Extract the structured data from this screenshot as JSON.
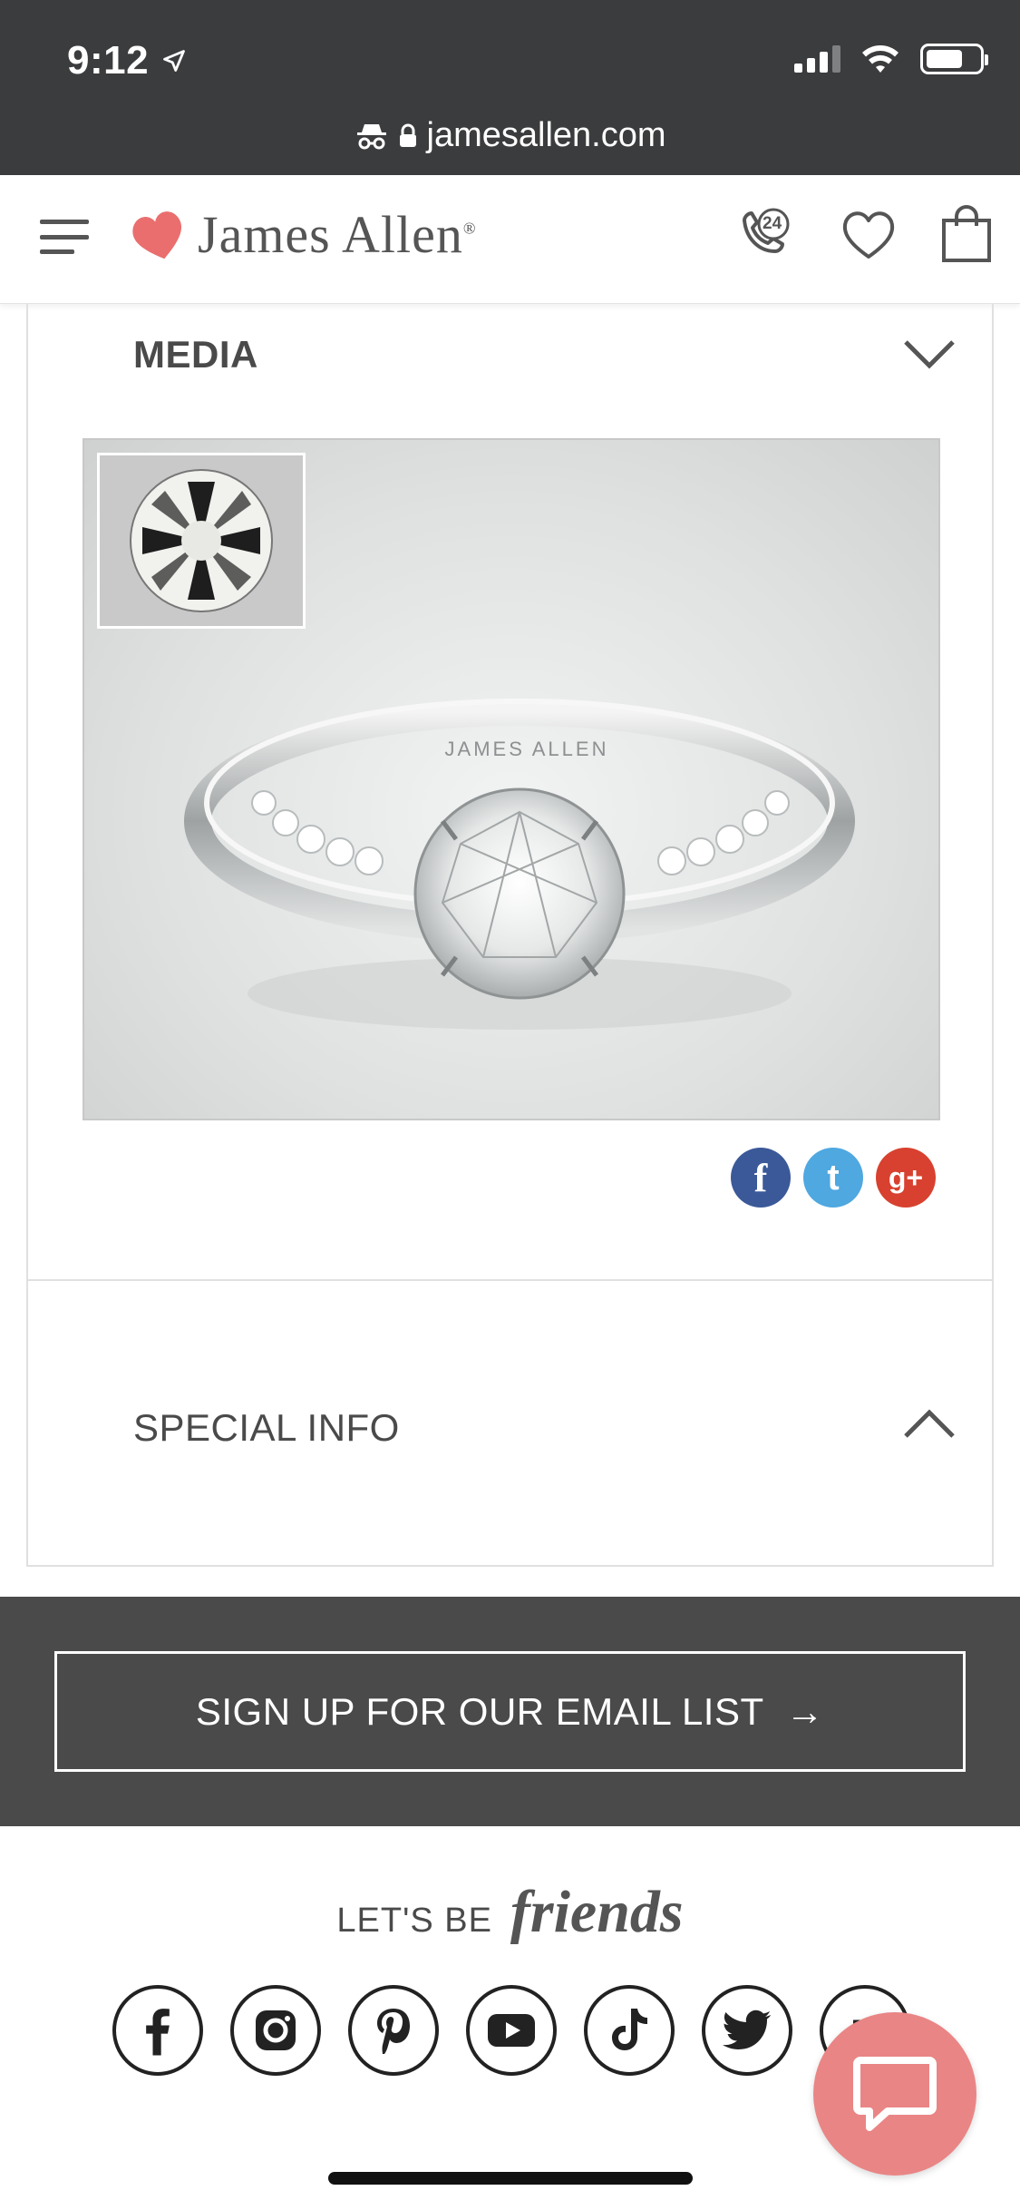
{
  "status_bar": {
    "time": "9:12",
    "url": "jamesallen.com"
  },
  "header": {
    "brand": "James Allen",
    "support_badge": "24"
  },
  "media": {
    "title": "MEDIA",
    "watermark": "JAMES ALLEN",
    "share": [
      {
        "name": "facebook",
        "color": "#3b5998"
      },
      {
        "name": "twitter",
        "color": "#4fa8e0"
      },
      {
        "name": "google-plus",
        "color": "#d8412f"
      }
    ]
  },
  "special_info": {
    "title": "SPECIAL INFO"
  },
  "email": {
    "label": "SIGN UP FOR OUR EMAIL LIST",
    "arrow": "→"
  },
  "friends": {
    "lead": "LET'S BE",
    "word": "friends",
    "partial_label": "Bl"
  },
  "colors": {
    "topbar": "#3b3c3e",
    "accent": "#ea8585",
    "band": "#4a4a4a"
  }
}
